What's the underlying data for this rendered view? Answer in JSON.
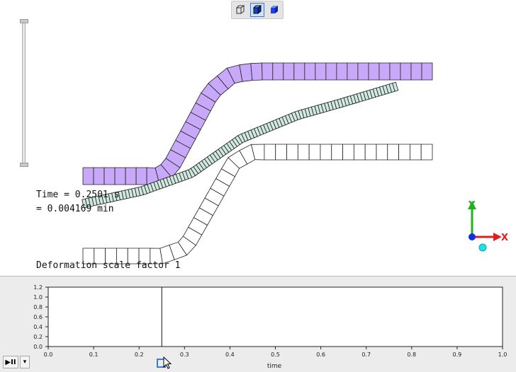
{
  "toolbar": {
    "buttons": [
      {
        "icon": "wireframe-cube-icon",
        "active": false
      },
      {
        "icon": "solid-cube-icon",
        "active": true
      },
      {
        "icon": "shaded-cube-icon",
        "active": false
      }
    ]
  },
  "viewport": {
    "time_line1": "Time = 0.2501 s",
    "time_line2": "= 0.004169 min",
    "deformation_label": "Deformation scale factor 1",
    "axes": {
      "x_label": "X",
      "y_label": "Y"
    },
    "colors": {
      "purple_mesh": "#c8a8f8",
      "beam_mesh": "#cfe8e0",
      "outline_mesh": "#ffffff",
      "x_axis": "#e02020",
      "y_axis": "#20b020",
      "z_dot": "#1030e0",
      "cyan_dot": "#20e0e8"
    }
  },
  "timeline": {
    "xlabel": "time",
    "xticks": [
      "0.0",
      "0.1",
      "0.2",
      "0.3",
      "0.4",
      "0.5",
      "0.6",
      "0.7",
      "0.8",
      "0.9",
      "1.0"
    ],
    "yticks": [
      "0.0",
      "0.2",
      "0.4",
      "0.6",
      "0.8",
      "1.0",
      "1.2"
    ],
    "xlim": [
      0,
      1.0
    ],
    "ylim": [
      0,
      1.2
    ],
    "current_time": 0.25,
    "play_label": "▶II",
    "menu_label": "▾"
  }
}
